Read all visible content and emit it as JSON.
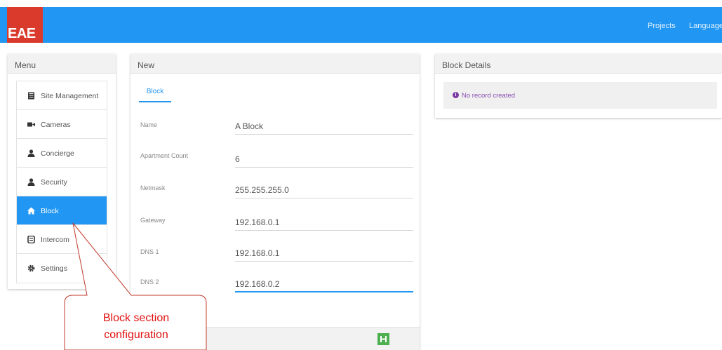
{
  "header": {
    "logo_text": "EAE",
    "nav": {
      "projects": "Projects",
      "language": "Language"
    },
    "colors": {
      "bar": "#2196f3",
      "logo": "#d93a2b"
    }
  },
  "menu": {
    "title": "Menu",
    "items": [
      {
        "label": "Site Management",
        "icon": "building-icon",
        "active": false
      },
      {
        "label": "Cameras",
        "icon": "video-camera-icon",
        "active": false
      },
      {
        "label": "Concierge",
        "icon": "user-icon",
        "active": false
      },
      {
        "label": "Security",
        "icon": "user-icon",
        "active": false
      },
      {
        "label": "Block",
        "icon": "home-icon",
        "active": true
      },
      {
        "label": "Intercom",
        "icon": "intercom-icon",
        "active": false
      },
      {
        "label": "Settings",
        "icon": "gear-icon",
        "active": false
      }
    ]
  },
  "new_panel": {
    "title": "New",
    "tab": "Block",
    "fields": [
      {
        "label": "Name",
        "value": "A Block"
      },
      {
        "label": "Apartment Count",
        "value": "6"
      },
      {
        "label": "Netmask",
        "value": "255.255.255.0"
      },
      {
        "label": "Gateway",
        "value": "192.168.0.1"
      },
      {
        "label": "DNS 1",
        "value": "192.168.0.1"
      },
      {
        "label": "DNS 2",
        "value": "192.168.0.2"
      }
    ],
    "save_icon": "save-icon"
  },
  "details": {
    "title": "Block Details",
    "message": "No record created",
    "message_icon": "info-icon"
  },
  "callout": {
    "line1": "Block section",
    "line2": "configuration",
    "color": "#e01010"
  }
}
